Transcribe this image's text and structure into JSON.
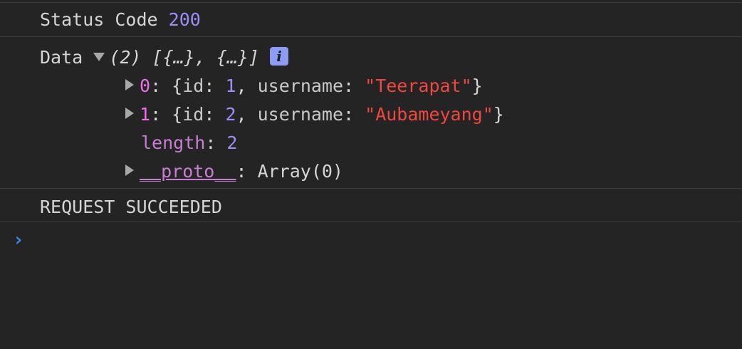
{
  "status": {
    "label": "Status Code",
    "code": "200"
  },
  "data": {
    "label": "Data",
    "summary": "(2) [{…}, {…}]",
    "info_glyph": "i",
    "items": [
      {
        "index": "0",
        "id": "1",
        "username": "\"Teerapat\""
      },
      {
        "index": "1",
        "id": "2",
        "username": "\"Aubameyang\""
      }
    ],
    "length_key": "length",
    "length_value": "2",
    "proto_key": "__proto__",
    "proto_value": "Array(0)",
    "id_key": "id",
    "username_key": "username"
  },
  "message": "REQUEST SUCCEEDED",
  "prompt_glyph": "›",
  "colors": {
    "background": "#242424",
    "number": "#9d8ef8",
    "string": "#f0473e",
    "key": "#c77fd1",
    "prompt": "#3d8bf0"
  }
}
